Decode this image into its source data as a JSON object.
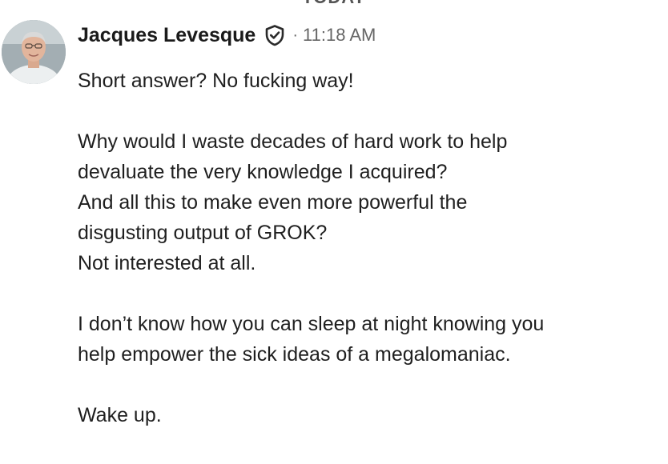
{
  "divider": {
    "label": "TODAY"
  },
  "message": {
    "sender": "Jacques Levesque",
    "verified_icon": "verified-shield-icon",
    "separator": "·",
    "time": "11:18 AM",
    "paragraphs": [
      [
        "Short answer? No fucking way!"
      ],
      [
        "Why would I waste decades of hard work to help",
        "devaluate the very knowledge I acquired?",
        "And all this to make even more powerful the",
        "disgusting output of GROK?",
        "Not interested at all."
      ],
      [
        "I don’t know how you can sleep at night knowing you",
        "help empower the sick ideas of a megalomaniac."
      ],
      [
        "Wake up."
      ]
    ]
  },
  "colors": {
    "text": "#1f1f1f",
    "muted": "#666666"
  }
}
